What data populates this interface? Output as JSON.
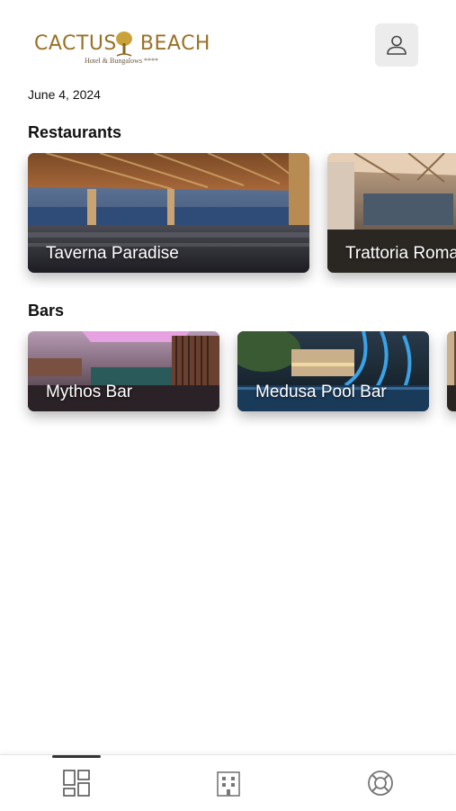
{
  "header": {
    "logo_text_left": "CACTUS",
    "logo_text_right": "BEACH",
    "logo_subtitle": "Hotel & Bungalows ****",
    "profile_icon": "user-icon"
  },
  "date": "June 4, 2024",
  "restaurants": {
    "title": "Restaurants",
    "items": [
      {
        "name": "Taverna Paradise"
      },
      {
        "name": "Trattoria Roma"
      }
    ]
  },
  "bars": {
    "title": "Bars",
    "items": [
      {
        "name": "Mythos Bar"
      },
      {
        "name": "Medusa Pool Bar"
      },
      {
        "name": ""
      }
    ]
  },
  "tabbar": {
    "tabs": [
      {
        "icon": "dashboard-icon",
        "active": true
      },
      {
        "icon": "building-icon",
        "active": false
      },
      {
        "icon": "lifebuoy-icon",
        "active": false
      }
    ]
  },
  "colors": {
    "brand_gold": "#9a7126",
    "profile_bg": "#ececec"
  }
}
